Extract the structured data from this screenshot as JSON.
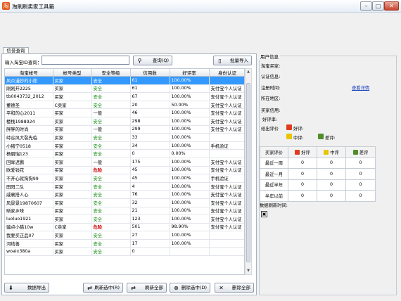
{
  "window": {
    "title": "淘刷刷卖家工具箱"
  },
  "tab": {
    "label": "信誉查询"
  },
  "search": {
    "label": "输入淘宝ID查询：",
    "value": "",
    "query_button": "查询(Q)",
    "batch_import": "批量导入"
  },
  "table": {
    "headers": [
      "淘宝帐号",
      "帐号类型",
      "安全等级",
      "信用数",
      "好评率",
      "身份认证"
    ],
    "rows": [
      [
        "风炎漫妙的小熊",
        "买家",
        "安全",
        "61",
        "100.00%",
        ""
      ],
      [
        "刚刚开2225",
        "买家",
        "安全",
        "61",
        "100.00%",
        "支付宝个人认证"
      ],
      [
        "tb0043732_2012",
        "买家",
        "安全",
        "67",
        "100.00%",
        "支付宝个人认证"
      ],
      [
        "董德圣",
        "C卖家",
        "安全",
        "20",
        "50.00%",
        "支付宝个人认证"
      ],
      [
        "平和的心2011",
        "买家",
        "一般",
        "46",
        "100.00%",
        "支付宝个人认证"
      ],
      [
        "楼栈1988924",
        "买家",
        "安全",
        "298",
        "100.00%",
        "支付宝个人认证"
      ],
      [
        "胖胖的时尚",
        "买家",
        "一般",
        "299",
        "100.00%",
        "支付宝个人认证"
      ],
      [
        "峙谷风大裂先临",
        "买家",
        "安全",
        "33",
        "100.00%",
        ""
      ],
      [
        "小猪宁0518",
        "买家",
        "安全",
        "34",
        "100.00%",
        "手机验证"
      ],
      [
        "杨丽瑞123",
        "买家",
        "安全",
        "0",
        "0.00%",
        ""
      ],
      [
        "回眸迟鹏",
        "买家",
        "一般",
        "175",
        "100.00%",
        "支付宝个人认证"
      ],
      [
        "欧爱钱花",
        "买家",
        "危险",
        "45",
        "100.00%",
        "支付宝个人认证"
      ],
      [
        "不开心就狗狗99",
        "买家",
        "安全",
        "45",
        "100.00%",
        "手机验证"
      ],
      [
        "田阳二队",
        "买家",
        "安全",
        "4",
        "100.00%",
        "支付宝个人认证"
      ],
      [
        "戚裹搭人心",
        "买家",
        "安全",
        "76",
        "100.00%",
        "支付宝个人认证"
      ],
      [
        "风景景19870607",
        "买家",
        "安全",
        "32",
        "100.00%",
        "支付宝个人认证"
      ],
      [
        "晰家乡味",
        "买家",
        "安全",
        "21",
        "100.00%",
        "支付宝个人认证"
      ],
      [
        "luoluo1921",
        "买家",
        "安全",
        "123",
        "100.00%",
        "支付宝个人认证"
      ],
      [
        "骗点小猫10w",
        "C卖家",
        "危险",
        "501",
        "98.90%",
        "支付宝个人认证"
      ],
      [
        "我要买正品07",
        "买家",
        "安全",
        "27",
        "100.00%",
        ""
      ],
      [
        "河结善",
        "买家",
        "安全",
        "17",
        "100.00%",
        ""
      ],
      [
        "woaix380a",
        "买家",
        "安全",
        "0",
        "",
        ""
      ]
    ]
  },
  "bottom_buttons": {
    "export": "数据导出",
    "refresh_selected": "刷新选中(R)",
    "refresh_all": "刷新全部",
    "delete_selected": "删除选中(D)",
    "delete_all": "删除全部"
  },
  "user_info": {
    "title": "用户信息",
    "taobao_buyer": "淘宝买家:",
    "verify_info": "认证信息:",
    "register_time": "注册时间:",
    "view_details": "查看详情",
    "location": "所在地区:",
    "buyer_credit": "买家信用:",
    "good_rate": "好评率:",
    "given_ratings": "给出评价",
    "good": "好评:",
    "medium": "中评:",
    "bad": "差评:",
    "refresh_time": "数据刷新时间:"
  },
  "rating_table": {
    "headers": [
      "买家评价",
      "好评",
      "中评",
      "差评"
    ],
    "rows": [
      [
        "最近一周",
        "0",
        "0",
        "0"
      ],
      [
        "最近一月",
        "0",
        "0",
        "0"
      ],
      [
        "最近半年",
        "0",
        "0",
        "0"
      ],
      [
        "半年以前",
        "0",
        "0",
        "0"
      ]
    ]
  },
  "colors": {
    "selection": "#3399ff",
    "safe": "#0a8a0a",
    "danger": "#d10000",
    "link": "#1a3fbf"
  }
}
